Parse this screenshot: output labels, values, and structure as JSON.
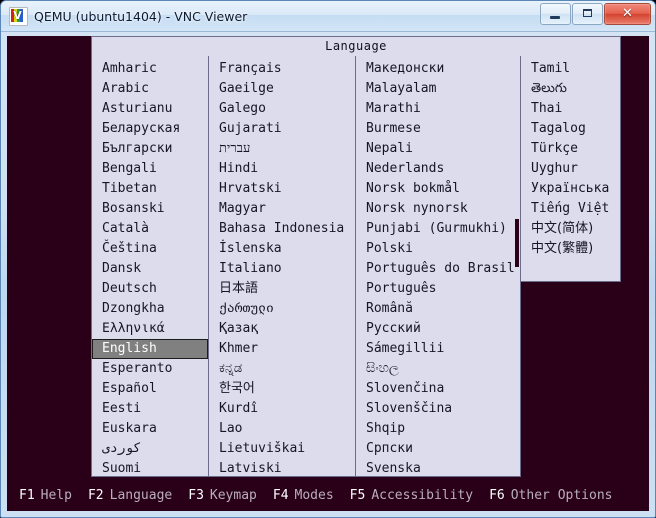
{
  "window": {
    "title": "QEMU (ubuntu1404) - VNC Viewer",
    "icon": "vnc-viewer-icon",
    "icon_glyph": "V",
    "buttons": {
      "minimize": "minimize-button",
      "restore": "restore-button",
      "close_glyph": "✕"
    }
  },
  "dialog": {
    "header": "Language",
    "selected": "English",
    "columns": [
      {
        "name": "language-column-1",
        "items": [
          {
            "label": "Amharic",
            "cjk": false,
            "selected": false
          },
          {
            "label": "Arabic",
            "cjk": false,
            "selected": false
          },
          {
            "label": "Asturianu",
            "cjk": false,
            "selected": false
          },
          {
            "label": "Беларуская",
            "cjk": false,
            "selected": false
          },
          {
            "label": "Български",
            "cjk": false,
            "selected": false
          },
          {
            "label": "Bengali",
            "cjk": false,
            "selected": false
          },
          {
            "label": "Tibetan",
            "cjk": false,
            "selected": false
          },
          {
            "label": "Bosanski",
            "cjk": false,
            "selected": false
          },
          {
            "label": "Català",
            "cjk": false,
            "selected": false
          },
          {
            "label": "Čeština",
            "cjk": false,
            "selected": false
          },
          {
            "label": "Dansk",
            "cjk": false,
            "selected": false
          },
          {
            "label": "Deutsch",
            "cjk": false,
            "selected": false
          },
          {
            "label": "Dzongkha",
            "cjk": false,
            "selected": false
          },
          {
            "label": "Ελληνικά",
            "cjk": false,
            "selected": false
          },
          {
            "label": "English",
            "cjk": false,
            "selected": true
          },
          {
            "label": "Esperanto",
            "cjk": false,
            "selected": false
          },
          {
            "label": "Español",
            "cjk": false,
            "selected": false
          },
          {
            "label": "Eesti",
            "cjk": false,
            "selected": false
          },
          {
            "label": "Euskara",
            "cjk": false,
            "selected": false
          },
          {
            "label": "کوردی",
            "cjk": false,
            "selected": false
          },
          {
            "label": "Suomi",
            "cjk": false,
            "selected": false
          }
        ]
      },
      {
        "name": "language-column-2",
        "items": [
          {
            "label": "Français",
            "cjk": false,
            "selected": false
          },
          {
            "label": "Gaeilge",
            "cjk": false,
            "selected": false
          },
          {
            "label": "Galego",
            "cjk": false,
            "selected": false
          },
          {
            "label": "Gujarati",
            "cjk": false,
            "selected": false
          },
          {
            "label": "עברית",
            "cjk": false,
            "selected": false
          },
          {
            "label": "Hindi",
            "cjk": false,
            "selected": false
          },
          {
            "label": "Hrvatski",
            "cjk": false,
            "selected": false
          },
          {
            "label": "Magyar",
            "cjk": false,
            "selected": false
          },
          {
            "label": "Bahasa Indonesia",
            "cjk": false,
            "selected": false
          },
          {
            "label": "İslenska",
            "cjk": false,
            "selected": false
          },
          {
            "label": "Italiano",
            "cjk": false,
            "selected": false
          },
          {
            "label": "日本語",
            "cjk": true,
            "selected": false
          },
          {
            "label": "ქართული",
            "cjk": false,
            "selected": false
          },
          {
            "label": "Қазақ",
            "cjk": false,
            "selected": false
          },
          {
            "label": "Khmer",
            "cjk": false,
            "selected": false
          },
          {
            "label": "ಕನ್ನಡ",
            "cjk": false,
            "selected": false
          },
          {
            "label": "한국어",
            "cjk": true,
            "selected": false
          },
          {
            "label": "Kurdî",
            "cjk": false,
            "selected": false
          },
          {
            "label": "Lao",
            "cjk": false,
            "selected": false
          },
          {
            "label": "Lietuviškai",
            "cjk": false,
            "selected": false
          },
          {
            "label": "Latviski",
            "cjk": false,
            "selected": false
          }
        ]
      },
      {
        "name": "language-column-3",
        "items": [
          {
            "label": "Македонски",
            "cjk": false,
            "selected": false
          },
          {
            "label": "Malayalam",
            "cjk": false,
            "selected": false
          },
          {
            "label": "Marathi",
            "cjk": false,
            "selected": false
          },
          {
            "label": "Burmese",
            "cjk": false,
            "selected": false
          },
          {
            "label": "Nepali",
            "cjk": false,
            "selected": false
          },
          {
            "label": "Nederlands",
            "cjk": false,
            "selected": false
          },
          {
            "label": "Norsk bokmål",
            "cjk": false,
            "selected": false
          },
          {
            "label": "Norsk nynorsk",
            "cjk": false,
            "selected": false
          },
          {
            "label": "Punjabi (Gurmukhi)",
            "cjk": false,
            "selected": false
          },
          {
            "label": "Polski",
            "cjk": false,
            "selected": false
          },
          {
            "label": "Português do Brasil",
            "cjk": false,
            "selected": false
          },
          {
            "label": "Português",
            "cjk": false,
            "selected": false
          },
          {
            "label": "Română",
            "cjk": false,
            "selected": false
          },
          {
            "label": "Русский",
            "cjk": false,
            "selected": false
          },
          {
            "label": "Sámegillii",
            "cjk": false,
            "selected": false
          },
          {
            "label": "සිංහල",
            "cjk": false,
            "selected": false
          },
          {
            "label": "Slovenčina",
            "cjk": false,
            "selected": false
          },
          {
            "label": "Slovenščina",
            "cjk": false,
            "selected": false
          },
          {
            "label": "Shqip",
            "cjk": false,
            "selected": false
          },
          {
            "label": "Српски",
            "cjk": false,
            "selected": false
          },
          {
            "label": "Svenska",
            "cjk": false,
            "selected": false
          }
        ]
      },
      {
        "name": "language-column-4",
        "items": [
          {
            "label": "Tamil",
            "cjk": false,
            "selected": false
          },
          {
            "label": "తెలుగు",
            "cjk": false,
            "selected": false
          },
          {
            "label": "Thai",
            "cjk": false,
            "selected": false
          },
          {
            "label": "Tagalog",
            "cjk": false,
            "selected": false
          },
          {
            "label": "Türkçe",
            "cjk": false,
            "selected": false
          },
          {
            "label": "Uyghur",
            "cjk": false,
            "selected": false
          },
          {
            "label": "Українська",
            "cjk": false,
            "selected": false
          },
          {
            "label": "Tiếng Việt",
            "cjk": false,
            "selected": false
          },
          {
            "label": "中文(简体)",
            "cjk": true,
            "selected": false
          },
          {
            "label": "中文(繁體)",
            "cjk": true,
            "selected": false
          }
        ]
      }
    ]
  },
  "fkeys": [
    {
      "key": "F1",
      "label": "Help"
    },
    {
      "key": "F2",
      "label": "Language"
    },
    {
      "key": "F3",
      "label": "Keymap"
    },
    {
      "key": "F4",
      "label": "Modes"
    },
    {
      "key": "F5",
      "label": "Accessibility"
    },
    {
      "key": "F6",
      "label": "Other Options"
    }
  ],
  "colors": {
    "panel_bg": "#dcdcec",
    "panel_border": "#6c6c8c",
    "screen_bg": "#2a0018",
    "selection_bg": "#808080",
    "fkey_key": "#ffffff",
    "fkey_label": "#b9aebd"
  }
}
